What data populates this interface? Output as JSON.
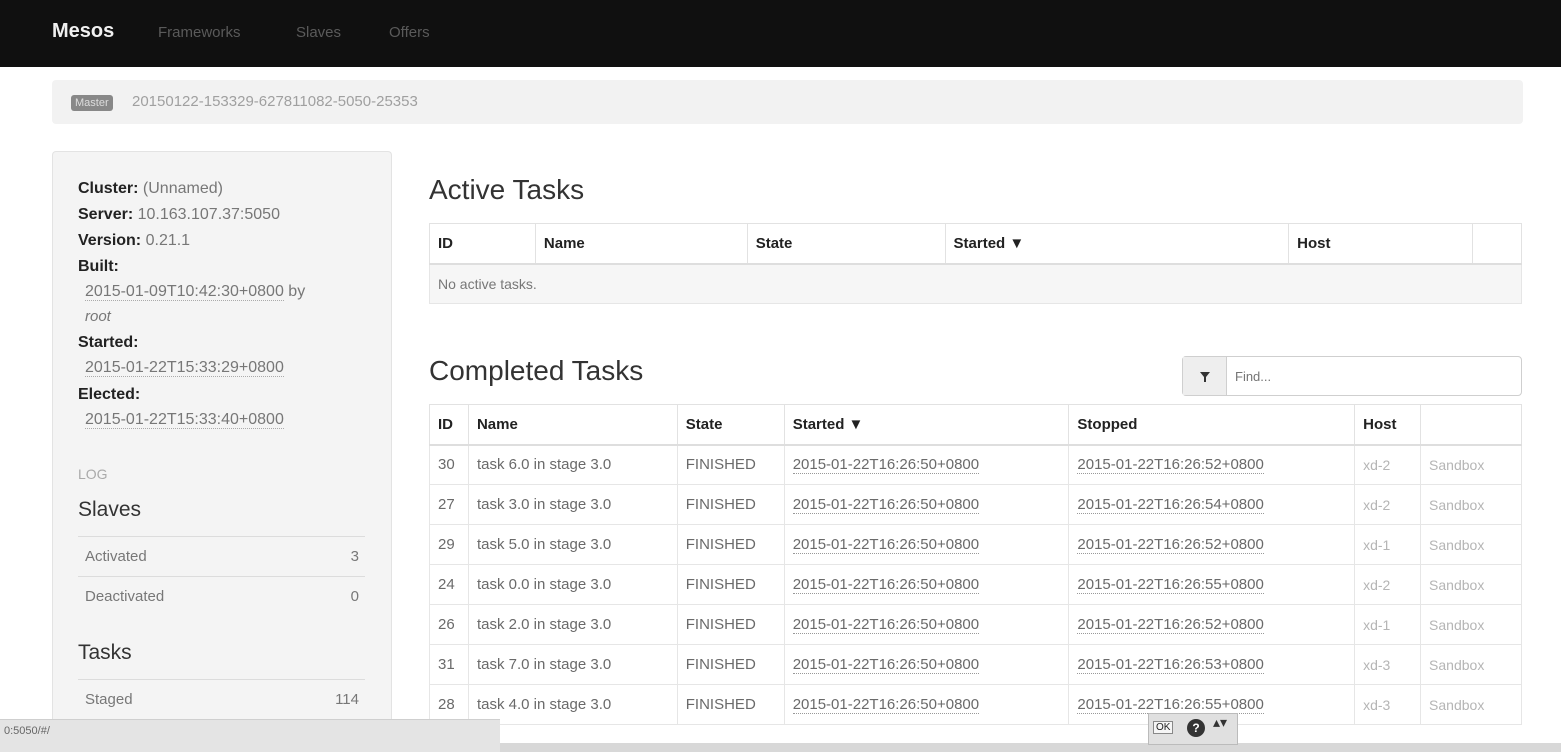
{
  "nav": {
    "brand": "Mesos",
    "links": [
      "Frameworks",
      "Slaves",
      "Offers"
    ]
  },
  "breadcrumb": {
    "badge": "Master",
    "id": "20150122-153329-627811082-5050-25353"
  },
  "sidebar": {
    "cluster_label": "Cluster:",
    "cluster_value": "(Unnamed)",
    "server_label": "Server:",
    "server_value": "10.163.107.37:5050",
    "version_label": "Version:",
    "version_value": "0.21.1",
    "built_label": "Built:",
    "built_value": "2015-01-09T10:42:30+0800",
    "built_by": "by",
    "built_user": "root",
    "started_label": "Started:",
    "started_value": "2015-01-22T15:33:29+0800",
    "elected_label": "Elected:",
    "elected_value": "2015-01-22T15:33:40+0800",
    "log_link": "LOG",
    "slaves_heading": "Slaves",
    "slaves": [
      {
        "label": "Activated",
        "value": "3"
      },
      {
        "label": "Deactivated",
        "value": "0"
      }
    ],
    "tasks_heading": "Tasks",
    "tasks": [
      {
        "label": "Staged",
        "value": "114"
      }
    ]
  },
  "active": {
    "heading": "Active Tasks",
    "columns": [
      "ID",
      "Name",
      "State",
      "Started ▼",
      "Host"
    ],
    "empty": "No active tasks."
  },
  "completed": {
    "heading": "Completed Tasks",
    "filter_icon": "filter-icon",
    "filter_placeholder": "Find...",
    "columns": [
      "ID",
      "Name",
      "State",
      "Started ▼",
      "Stopped",
      "Host"
    ],
    "rows": [
      {
        "id": "30",
        "name": "task 6.0 in stage 3.0",
        "state": "FINISHED",
        "started": "2015-01-22T16:26:50+0800",
        "stopped": "2015-01-22T16:26:52+0800",
        "host": "xd-2",
        "sandbox": "Sandbox"
      },
      {
        "id": "27",
        "name": "task 3.0 in stage 3.0",
        "state": "FINISHED",
        "started": "2015-01-22T16:26:50+0800",
        "stopped": "2015-01-22T16:26:54+0800",
        "host": "xd-2",
        "sandbox": "Sandbox"
      },
      {
        "id": "29",
        "name": "task 5.0 in stage 3.0",
        "state": "FINISHED",
        "started": "2015-01-22T16:26:50+0800",
        "stopped": "2015-01-22T16:26:52+0800",
        "host": "xd-1",
        "sandbox": "Sandbox"
      },
      {
        "id": "24",
        "name": "task 0.0 in stage 3.0",
        "state": "FINISHED",
        "started": "2015-01-22T16:26:50+0800",
        "stopped": "2015-01-22T16:26:55+0800",
        "host": "xd-2",
        "sandbox": "Sandbox"
      },
      {
        "id": "26",
        "name": "task 2.0 in stage 3.0",
        "state": "FINISHED",
        "started": "2015-01-22T16:26:50+0800",
        "stopped": "2015-01-22T16:26:52+0800",
        "host": "xd-1",
        "sandbox": "Sandbox"
      },
      {
        "id": "31",
        "name": "task 7.0 in stage 3.0",
        "state": "FINISHED",
        "started": "2015-01-22T16:26:50+0800",
        "stopped": "2015-01-22T16:26:53+0800",
        "host": "xd-3",
        "sandbox": "Sandbox"
      },
      {
        "id": "28",
        "name": "task 4.0 in stage 3.0",
        "state": "FINISHED",
        "started": "2015-01-22T16:26:50+0800",
        "stopped": "2015-01-22T16:26:55+0800",
        "host": "xd-3",
        "sandbox": "Sandbox"
      }
    ]
  },
  "status_bar": {
    "url": "0:5050/#/"
  },
  "mini_toolbar": {
    "ok": "OK",
    "help": "?",
    "arrows": "▴▾"
  }
}
